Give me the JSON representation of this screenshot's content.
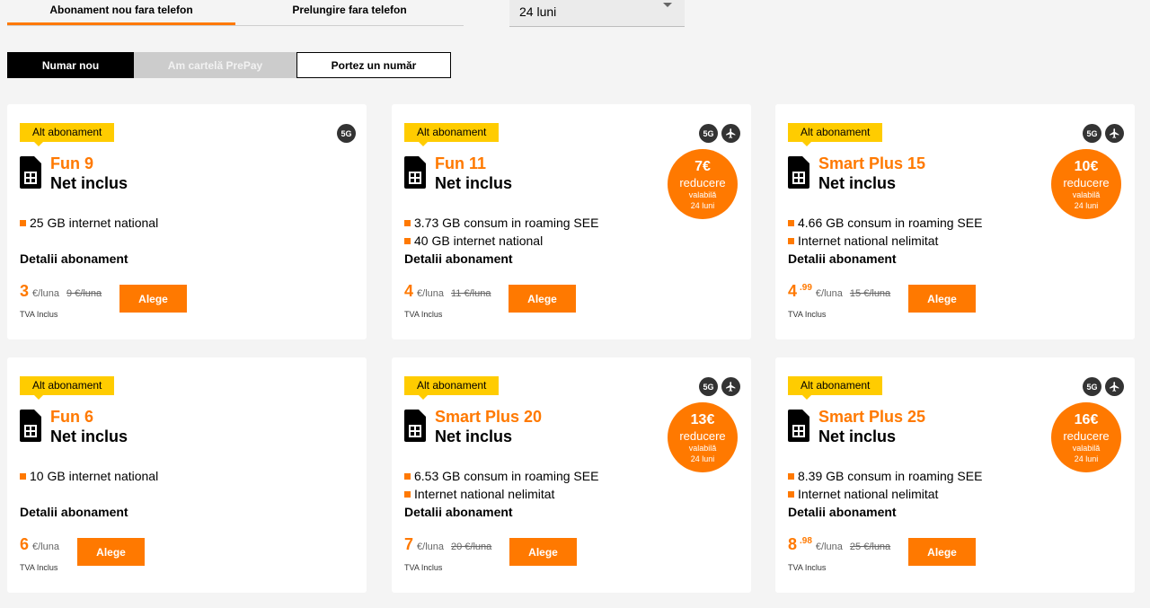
{
  "tabs": [
    {
      "label": "Abonament nou fara telefon",
      "active": true
    },
    {
      "label": "Prelungire fara telefon",
      "active": false
    }
  ],
  "period_select": {
    "value": "24 luni"
  },
  "number_options": {
    "new": "Numar nou",
    "prepay": "Am cartelă PrePay",
    "port": "Portez un număr"
  },
  "colors": {
    "accent": "#ff7900",
    "badge": "#ffcc00"
  },
  "cards": [
    {
      "badge": "Alt abonament",
      "icons": [
        "5G"
      ],
      "name": "Fun 9",
      "subtitle": "Net inclus",
      "discount": null,
      "features": [
        "25 GB internet national"
      ],
      "details": "Detalii abonament",
      "price": "3",
      "cents": "",
      "unit": "€/luna",
      "old_price": "9 €/luna",
      "tva": "TVA Inclus",
      "button": "Alege"
    },
    {
      "badge": "Alt abonament",
      "icons": [
        "5G",
        "airplane"
      ],
      "name": "Fun 11",
      "subtitle": "Net inclus",
      "discount": {
        "amount": "7€",
        "label": "reducere",
        "valid": "valabilă",
        "period": "24 luni"
      },
      "features": [
        "3.73 GB consum in roaming SEE",
        "40 GB internet national"
      ],
      "details": "Detalii abonament",
      "price": "4",
      "cents": "",
      "unit": "€/luna",
      "old_price": "11 €/luna",
      "tva": "TVA Inclus",
      "button": "Alege"
    },
    {
      "badge": "Alt abonament",
      "icons": [
        "5G",
        "airplane"
      ],
      "name": "Smart Plus 15",
      "subtitle": "Net inclus",
      "discount": {
        "amount": "10€",
        "label": "reducere",
        "valid": "valabilă",
        "period": "24 luni"
      },
      "features": [
        "4.66 GB consum in roaming SEE",
        "Internet national nelimitat"
      ],
      "details": "Detalii abonament",
      "price": "4",
      "cents": ".99",
      "unit": "€/luna",
      "old_price": "15 €/luna",
      "tva": "TVA Inclus",
      "button": "Alege"
    },
    {
      "badge": "Alt abonament",
      "icons": [],
      "name": "Fun 6",
      "subtitle": "Net inclus",
      "discount": null,
      "features": [
        "10 GB internet national"
      ],
      "details": "Detalii abonament",
      "price": "6",
      "cents": "",
      "unit": "€/luna",
      "old_price": "",
      "tva": "TVA Inclus",
      "button": "Alege"
    },
    {
      "badge": "Alt abonament",
      "icons": [
        "5G",
        "airplane"
      ],
      "name": "Smart Plus 20",
      "subtitle": "Net inclus",
      "discount": {
        "amount": "13€",
        "label": "reducere",
        "valid": "valabilă",
        "period": "24 luni"
      },
      "features": [
        "6.53 GB consum in roaming SEE",
        "Internet national nelimitat"
      ],
      "details": "Detalii abonament",
      "price": "7",
      "cents": "",
      "unit": "€/luna",
      "old_price": "20 €/luna",
      "tva": "TVA Inclus",
      "button": "Alege"
    },
    {
      "badge": "Alt abonament",
      "icons": [
        "5G",
        "airplane"
      ],
      "name": "Smart Plus 25",
      "subtitle": "Net inclus",
      "discount": {
        "amount": "16€",
        "label": "reducere",
        "valid": "valabilă",
        "period": "24 luni"
      },
      "features": [
        "8.39 GB consum in roaming SEE",
        "Internet national nelimitat"
      ],
      "details": "Detalii abonament",
      "price": "8",
      "cents": ".98",
      "unit": "€/luna",
      "old_price": "25 €/luna",
      "tva": "TVA Inclus",
      "button": "Alege"
    }
  ]
}
